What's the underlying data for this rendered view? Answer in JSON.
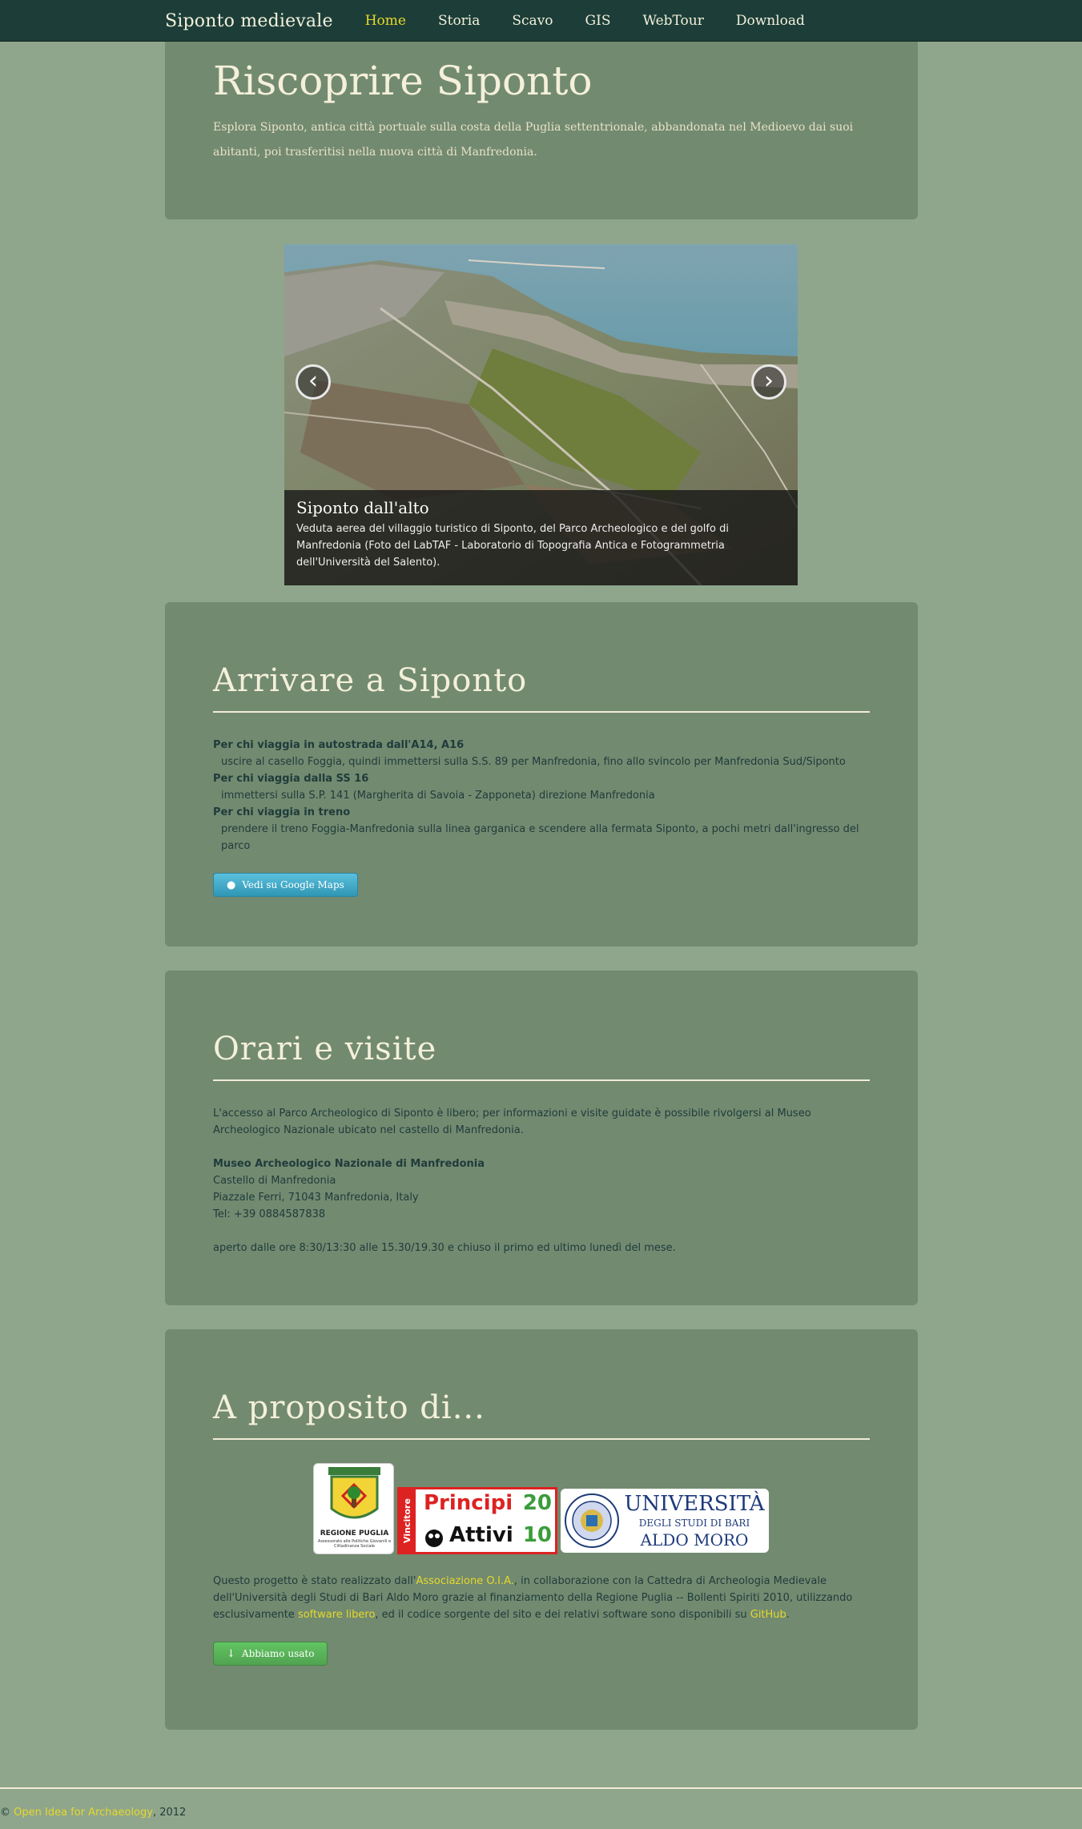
{
  "navbar": {
    "brand": "Siponto medievale",
    "items": [
      {
        "label": "Home",
        "active": true
      },
      {
        "label": "Storia"
      },
      {
        "label": "Scavo"
      },
      {
        "label": "GIS"
      },
      {
        "label": "WebTour"
      },
      {
        "label": "Download"
      }
    ]
  },
  "hero": {
    "title": "Riscoprire Siponto",
    "text": "Esplora Siponto, antica città portuale sulla costa della Puglia settentrionale, abbandonata nel Medioevo dai suoi abitanti, poi trasferitisi nella nuova città di Manfredonia."
  },
  "carousel": {
    "prev": "‹",
    "next": "›",
    "caption_title": "Siponto dall'alto",
    "caption_text": "Veduta aerea del villaggio turistico di Siponto, del Parco Archeologico e del golfo di Manfredonia (Foto del LabTAF - Laboratorio di Topografia Antica e Fotogrammetria dell'Università del Salento)."
  },
  "arrivare": {
    "title": "Arrivare a Siponto",
    "h1": "Per chi viaggia in autostrada dall'A14, A16",
    "t1": "uscire al casello Foggia, quindi immettersi sulla S.S. 89 per Manfredonia, fino allo svincolo per Manfredonia Sud/Siponto",
    "h2": "Per chi viaggia dalla SS 16",
    "t2": "immettersi sulla S.P. 141 (Margherita di Savoia - Zapponeta) direzione Manfredonia",
    "h3": "Per chi viaggia in treno",
    "t3": "prendere il treno Foggia-Manfredonia sulla linea garganica e scendere alla fermata Siponto, a pochi metri dall'ingresso del parco",
    "button": "Vedi su Google Maps"
  },
  "orari": {
    "title": "Orari e visite",
    "intro": "L'accesso al Parco Archeologico di Siponto è libero; per informazioni e visite guidate è possibile rivolgersi al Museo Archeologico Nazionale ubicato nel castello di Manfredonia.",
    "museum_name": "Museo Archeologico Nazionale di Manfredonia",
    "line1": "Castello di Manfredonia",
    "line2": "Piazzale Ferri, 71043 Manfredonia, Italy",
    "line3": "Tel: +39 0884587838",
    "hours": "aperto dalle ore 8:30/13:30 alle 15.30/19.30 e chiuso il primo ed ultimo lunedì del mese."
  },
  "about": {
    "title": "A proposito di...",
    "logo1_text": "REGIONE PUGLIA",
    "logo1_sub": "Assessorato alle Politiche Giovanili e Cittadinanza Sociale",
    "logo2_side": "Vincitore",
    "logo2_top": "Principi",
    "logo2_bottom": "Attivi",
    "logo2_year_a": "20",
    "logo2_year_b": "10",
    "logo3_line1": "UNIVERSITÀ",
    "logo3_line2": "DEGLI STUDI DI BARI",
    "logo3_line3": "ALDO MORO",
    "p_a": "Questo progetto è stato realizzato dall'",
    "link1": "Associazione O.I.A.",
    "p_b": ", in collaborazione con la Cattedra di Archeologia Medievale dell'Università degli Studi di Bari Aldo Moro grazie al finanziamento della Regione Puglia -- Bollenti Spiriti 2010, utilizzando esclusivamente ",
    "link2": "software libero",
    "p_c": ", ed il codice sorgente del sito e dei relativi software sono disponibili su ",
    "link3": "GitHub",
    "p_d": ".",
    "button": "Abbiamo usato"
  },
  "footer": {
    "copy": "©",
    "link": "Open Idea for Archaeology",
    "year": ", 2012"
  },
  "colors": {
    "background": "#8fa68c",
    "panel": "#728a70",
    "navbar": "#1d3e38",
    "accent": "#e6d82a"
  }
}
